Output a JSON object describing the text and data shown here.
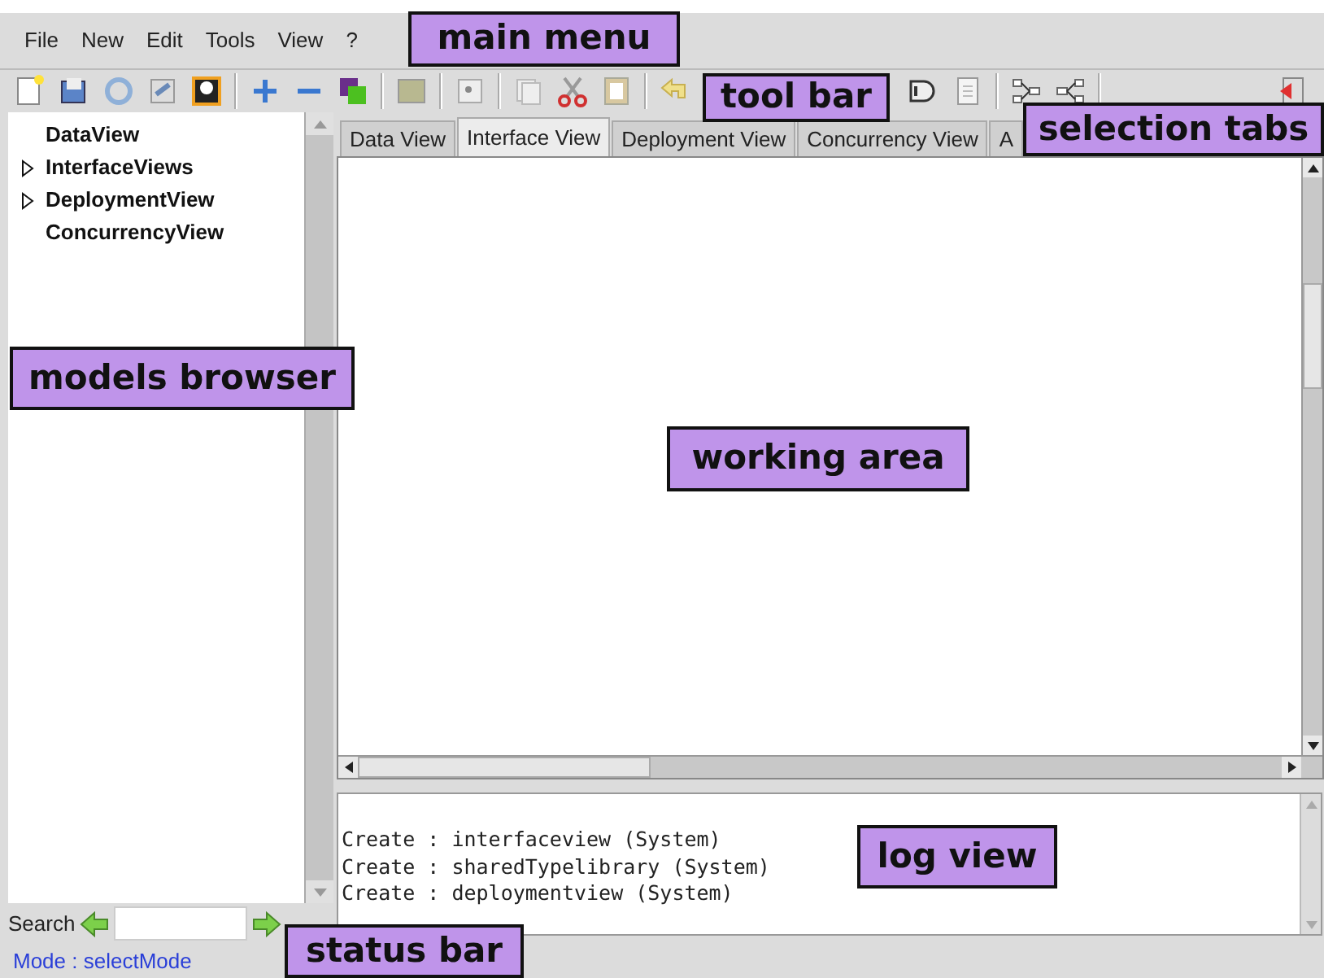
{
  "menu": [
    "File",
    "New",
    "Edit",
    "Tools",
    "View",
    "?"
  ],
  "tree": [
    {
      "label": "DataView",
      "kind": "leaf"
    },
    {
      "label": "InterfaceViews",
      "kind": "collapsed"
    },
    {
      "label": "DeploymentView",
      "kind": "collapsed"
    },
    {
      "label": "ConcurrencyView",
      "kind": "leaf"
    }
  ],
  "tabs": [
    {
      "label": "Data View",
      "selected": false
    },
    {
      "label": "Interface View",
      "selected": true
    },
    {
      "label": "Deployment View",
      "selected": false
    },
    {
      "label": "Concurrency View",
      "selected": false
    },
    {
      "label": "A",
      "selected": false
    }
  ],
  "log": [
    "Create : interfaceview (System)",
    "Create : sharedTypelibrary (System)",
    "Create : deploymentview (System)"
  ],
  "search": {
    "label": "Search"
  },
  "status_bar": "Mode : selectMode",
  "callouts": [
    "main menu",
    "tool bar",
    "selection tabs",
    "models browser",
    "working area",
    "log view",
    "status bar"
  ]
}
